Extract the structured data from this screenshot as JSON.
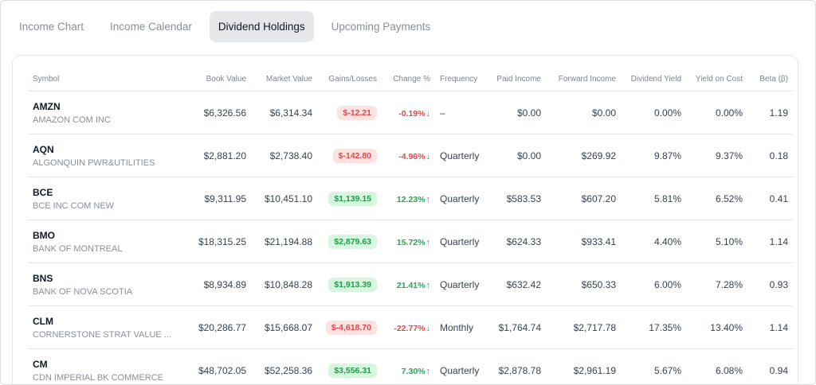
{
  "tabs": [
    {
      "label": "Income Chart",
      "active": false
    },
    {
      "label": "Income Calendar",
      "active": false
    },
    {
      "label": "Dividend Holdings",
      "active": true
    },
    {
      "label": "Upcoming Payments",
      "active": false
    }
  ],
  "columns": [
    "Symbol",
    "Book Value",
    "Market Value",
    "Gains/Losses",
    "Change %",
    "Frequency",
    "Paid Income",
    "Forward Income",
    "Dividend Yield",
    "Yield on Cost",
    "Beta (β)"
  ],
  "rows": [
    {
      "symbol": "AMZN",
      "name": "AMAZON COM INC",
      "book": "$6,326.56",
      "market": "$6,314.34",
      "gain": "$-12.21",
      "gain_dir": "neg",
      "change": "-0.19%",
      "change_dir": "neg",
      "frequency": "–",
      "paid": "$0.00",
      "forward": "$0.00",
      "div_yield": "0.00%",
      "yoc": "0.00%",
      "beta": "1.19"
    },
    {
      "symbol": "AQN",
      "name": "ALGONQUIN PWR&UTILITIES",
      "book": "$2,881.20",
      "market": "$2,738.40",
      "gain": "$-142.80",
      "gain_dir": "neg",
      "change": "-4.96%",
      "change_dir": "neg",
      "frequency": "Quarterly",
      "paid": "$0.00",
      "forward": "$269.92",
      "div_yield": "9.87%",
      "yoc": "9.37%",
      "beta": "0.18"
    },
    {
      "symbol": "BCE",
      "name": "BCE INC COM NEW",
      "book": "$9,311.95",
      "market": "$10,451.10",
      "gain": "$1,139.15",
      "gain_dir": "pos",
      "change": "12.23%",
      "change_dir": "pos",
      "frequency": "Quarterly",
      "paid": "$583.53",
      "forward": "$607.20",
      "div_yield": "5.81%",
      "yoc": "6.52%",
      "beta": "0.41"
    },
    {
      "symbol": "BMO",
      "name": "BANK OF MONTREAL",
      "book": "$18,315.25",
      "market": "$21,194.88",
      "gain": "$2,879.63",
      "gain_dir": "pos",
      "change": "15.72%",
      "change_dir": "pos",
      "frequency": "Quarterly",
      "paid": "$624.33",
      "forward": "$933.41",
      "div_yield": "4.40%",
      "yoc": "5.10%",
      "beta": "1.14"
    },
    {
      "symbol": "BNS",
      "name": "BANK OF NOVA SCOTIA",
      "book": "$8,934.89",
      "market": "$10,848.28",
      "gain": "$1,913.39",
      "gain_dir": "pos",
      "change": "21.41%",
      "change_dir": "pos",
      "frequency": "Quarterly",
      "paid": "$632.42",
      "forward": "$650.33",
      "div_yield": "6.00%",
      "yoc": "7.28%",
      "beta": "0.93"
    },
    {
      "symbol": "CLM",
      "name": "CORNERSTONE STRAT VALUE ...",
      "book": "$20,286.77",
      "market": "$15,668.07",
      "gain": "$-4,618.70",
      "gain_dir": "neg",
      "change": "-22.77%",
      "change_dir": "neg",
      "frequency": "Monthly",
      "paid": "$1,764.74",
      "forward": "$2,717.78",
      "div_yield": "17.35%",
      "yoc": "13.40%",
      "beta": "1.14"
    },
    {
      "symbol": "CM",
      "name": "CDN IMPERIAL BK COMMERCE",
      "book": "$48,702.05",
      "market": "$52,258.36",
      "gain": "$3,556.31",
      "gain_dir": "pos",
      "change": "7.30%",
      "change_dir": "pos",
      "frequency": "Quarterly",
      "paid": "$2,878.78",
      "forward": "$2,961.19",
      "div_yield": "5.67%",
      "yoc": "6.08%",
      "beta": "0.94"
    }
  ],
  "colors": {
    "positive": "#1f9d49",
    "negative": "#e04848",
    "tab_active_bg": "#e5e7eb"
  }
}
